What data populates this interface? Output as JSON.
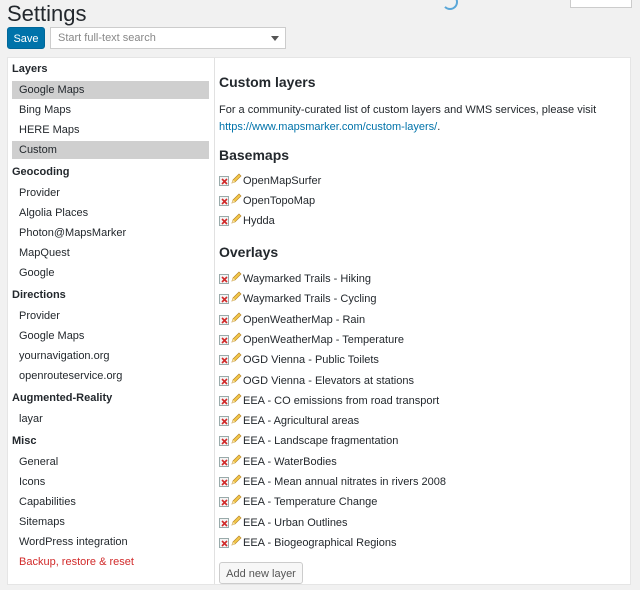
{
  "header": {
    "title": "Settings",
    "save_label": "Save",
    "search_placeholder": "Start full-text search"
  },
  "sidebar": {
    "sections": [
      {
        "title": "Layers",
        "items": [
          {
            "label": "Google Maps",
            "active": true
          },
          {
            "label": "Bing Maps"
          },
          {
            "label": "HERE Maps"
          },
          {
            "label": "Custom",
            "active": true
          }
        ]
      },
      {
        "title": "Geocoding",
        "items": [
          {
            "label": "Provider"
          },
          {
            "label": "Algolia Places"
          },
          {
            "label": "Photon@MapsMarker"
          },
          {
            "label": "MapQuest"
          },
          {
            "label": "Google"
          }
        ]
      },
      {
        "title": "Directions",
        "items": [
          {
            "label": "Provider"
          },
          {
            "label": "Google Maps"
          },
          {
            "label": "yournavigation.org"
          },
          {
            "label": "openrouteservice.org"
          }
        ]
      },
      {
        "title": "Augmented-Reality",
        "items": [
          {
            "label": "layar"
          }
        ]
      },
      {
        "title": "Misc",
        "items": [
          {
            "label": "General"
          },
          {
            "label": "Icons"
          },
          {
            "label": "Capabilities"
          },
          {
            "label": "Sitemaps"
          },
          {
            "label": "WordPress integration"
          },
          {
            "label": "Backup, restore & reset",
            "danger": true
          }
        ]
      }
    ]
  },
  "main": {
    "title": "Custom layers",
    "description": "For a community-curated list of custom layers and WMS services, please visit",
    "link": "https://www.mapsmarker.com/custom-layers/",
    "link_suffix": ".",
    "basemaps_title": "Basemaps",
    "basemaps": [
      "OpenMapSurfer",
      "OpenTopoMap",
      "Hydda"
    ],
    "overlays_title": "Overlays",
    "overlays": [
      "Waymarked Trails - Hiking",
      "Waymarked Trails - Cycling",
      "OpenWeatherMap - Rain",
      "OpenWeatherMap - Temperature",
      "OGD Vienna - Public Toilets",
      "OGD Vienna - Elevators at stations",
      "EEA - CO emissions from road transport",
      "EEA - Agricultural areas",
      "EEA - Landscape fragmentation",
      "EEA - WaterBodies",
      "EEA - Mean annual nitrates in rivers 2008",
      "EEA - Temperature Change",
      "EEA - Urban Outlines",
      "EEA - Biogeographical Regions"
    ],
    "add_label": "Add new layer"
  },
  "colors": {
    "primary": "#0073aa",
    "danger": "#d12a2a",
    "active_bg": "#cfcfcf"
  }
}
